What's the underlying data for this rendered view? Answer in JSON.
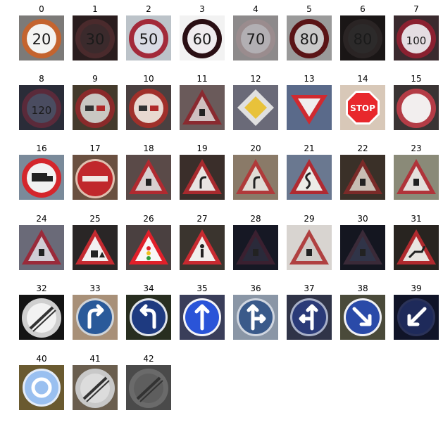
{
  "thumbnails": [
    {
      "label": "0",
      "shape": "circle-speed",
      "text": "20",
      "bg": "#7c7a78",
      "fill": "#f4f4f2",
      "ring": "#c4642f"
    },
    {
      "label": "1",
      "shape": "circle-speed",
      "text": "30",
      "bg": "#2a1d1e",
      "fill": "#3b2a2c",
      "ring": "#4a2a2c"
    },
    {
      "label": "2",
      "shape": "circle-speed",
      "text": "50",
      "bg": "#bcc3c9",
      "fill": "#d8dbe4",
      "ring": "#a32a3a"
    },
    {
      "label": "3",
      "shape": "circle-speed",
      "text": "60",
      "bg": "#f2f2f2",
      "fill": "#f0ecef",
      "ring": "#2a0f14"
    },
    {
      "label": "4",
      "shape": "circle-speed",
      "text": "70",
      "bg": "#8d8a8b",
      "fill": "#b2afb3",
      "ring": "#9a8c8e"
    },
    {
      "label": "5",
      "shape": "circle-speed",
      "text": "80",
      "bg": "#9a9a9a",
      "fill": "#c9c9c9",
      "ring": "#5a1416"
    },
    {
      "label": "6",
      "shape": "circle-speed",
      "text": "80",
      "bg": "#1a1616",
      "fill": "#2c2a2a",
      "ring": "#2a2424"
    },
    {
      "label": "7",
      "shape": "circle-speed",
      "text": "100",
      "bg": "#3a2a2e",
      "fill": "#e4dde2",
      "ring": "#8a2030"
    },
    {
      "label": "8",
      "shape": "circle-speed",
      "text": "120",
      "bg": "#2a2c38",
      "fill": "#4a4c60",
      "ring": "#5a2a3a"
    },
    {
      "label": "9",
      "shape": "circle-cars",
      "text": "",
      "bg": "#443a2c",
      "fill": "#c9c7c2",
      "ring": "#8a2a2a"
    },
    {
      "label": "10",
      "shape": "circle-cars",
      "text": "",
      "bg": "#4a4040",
      "fill": "#e8d8d0",
      "ring": "#a0302a"
    },
    {
      "label": "11",
      "shape": "triangle",
      "text": "",
      "bg": "#6a5a5a",
      "fill": "#cfc0c0",
      "ring": "#8a2a30"
    },
    {
      "label": "12",
      "shape": "diamond",
      "text": "",
      "bg": "#6a6a78",
      "fill": "#e8c23a",
      "ring": "#e0e0e0"
    },
    {
      "label": "13",
      "shape": "triangle-down",
      "text": "",
      "bg": "#5a6a8a",
      "fill": "#f0eeee",
      "ring": "#d02a30"
    },
    {
      "label": "14",
      "shape": "stop",
      "text": "STOP",
      "bg": "#d8c8b8",
      "fill": "#e8282c",
      "ring": "#ffffff"
    },
    {
      "label": "15",
      "shape": "circle-empty",
      "text": "",
      "bg": "#3a3434",
      "fill": "#f2eeee",
      "ring": "#b43c46"
    },
    {
      "label": "16",
      "shape": "circle-truck",
      "text": "",
      "bg": "#7a8a9a",
      "fill": "#f2f2f2",
      "ring": "#d4262c"
    },
    {
      "label": "17",
      "shape": "no-entry",
      "text": "",
      "bg": "#6a5040",
      "fill": "#c0282c",
      "ring": "#e0c0b0"
    },
    {
      "label": "18",
      "shape": "triangle",
      "text": "",
      "bg": "#5a4a48",
      "fill": "#d8d0d0",
      "ring": "#b02a30"
    },
    {
      "label": "19",
      "shape": "triangle-curve",
      "text": "",
      "bg": "#3a2e2a",
      "fill": "#e8e4e2",
      "ring": "#a82a2e"
    },
    {
      "label": "20",
      "shape": "triangle-curve",
      "text": "",
      "bg": "#8a7a68",
      "fill": "#e0dcd6",
      "ring": "#b03a3a"
    },
    {
      "label": "21",
      "shape": "triangle-double",
      "text": "",
      "bg": "#6a7890",
      "fill": "#ecece8",
      "ring": "#b02a32"
    },
    {
      "label": "22",
      "shape": "triangle",
      "text": "",
      "bg": "#3a3028",
      "fill": "#c8beb4",
      "ring": "#7a2a28"
    },
    {
      "label": "23",
      "shape": "triangle",
      "text": "",
      "bg": "#8a8a78",
      "fill": "#e4e0dc",
      "ring": "#b0343a"
    },
    {
      "label": "24",
      "shape": "triangle",
      "text": "",
      "bg": "#6a6a78",
      "fill": "#d0ccd4",
      "ring": "#9a2a3a"
    },
    {
      "label": "25",
      "shape": "triangle-work",
      "text": "",
      "bg": "#2a2626",
      "fill": "#f2f0f0",
      "ring": "#c42a30"
    },
    {
      "label": "26",
      "shape": "triangle-signal",
      "text": "",
      "bg": "#4a4040",
      "fill": "#f8f6f6",
      "ring": "#e0202a"
    },
    {
      "label": "27",
      "shape": "triangle-person",
      "text": "",
      "bg": "#3a342e",
      "fill": "#f0eeec",
      "ring": "#c82a30"
    },
    {
      "label": "28",
      "shape": "triangle",
      "text": "",
      "bg": "#161824",
      "fill": "#2a2a3a",
      "ring": "#3a2030"
    },
    {
      "label": "29",
      "shape": "triangle",
      "text": "",
      "bg": "#d8d4d0",
      "fill": "#d0ccc8",
      "ring": "#b04040"
    },
    {
      "label": "30",
      "shape": "triangle",
      "text": "",
      "bg": "#141620",
      "fill": "#303448",
      "ring": "#3a2a38"
    },
    {
      "label": "31",
      "shape": "triangle-deer",
      "text": "",
      "bg": "#282420",
      "fill": "#e8e4e0",
      "ring": "#b02a2e"
    },
    {
      "label": "32",
      "shape": "circle-end",
      "text": "",
      "bg": "#141414",
      "fill": "#f2f2f2",
      "ring": "#cfcfcf"
    },
    {
      "label": "33",
      "shape": "blue-turn-right",
      "text": "",
      "bg": "#a89078",
      "fill": "#2a5a9a",
      "ring": "#d0d4d8"
    },
    {
      "label": "34",
      "shape": "blue-turn-left",
      "text": "",
      "bg": "#282e20",
      "fill": "#1e3a80",
      "ring": "#e0e4ea"
    },
    {
      "label": "35",
      "shape": "blue-ahead",
      "text": "",
      "bg": "#3a3e5a",
      "fill": "#2a54d8",
      "ring": "#f4f4f8"
    },
    {
      "label": "36",
      "shape": "blue-ahead-right",
      "text": "",
      "bg": "#8a96a6",
      "fill": "#3a5a8a",
      "ring": "#d0d6e0"
    },
    {
      "label": "37",
      "shape": "blue-ahead-left",
      "text": "",
      "bg": "#303448",
      "fill": "#2a3a78",
      "ring": "#a8b0c8"
    },
    {
      "label": "38",
      "shape": "blue-keep-right",
      "text": "",
      "bg": "#4a4a3a",
      "fill": "#2a4aa8",
      "ring": "#f0f0f4"
    },
    {
      "label": "39",
      "shape": "blue-keep-left",
      "text": "",
      "bg": "#101428",
      "fill": "#1e2a5a",
      "ring": "#2a3258"
    },
    {
      "label": "40",
      "shape": "blue-roundabout",
      "text": "",
      "bg": "#6a5a30",
      "fill": "#9ac0f0",
      "ring": "#e4ecf8"
    },
    {
      "label": "41",
      "shape": "circle-end-nopass",
      "text": "",
      "bg": "#6a5e4e",
      "fill": "#dcdcdc",
      "ring": "#c8c8c8"
    },
    {
      "label": "42",
      "shape": "circle-end-nopass",
      "text": "",
      "bg": "#4a4a4a",
      "fill": "#5e5e5e",
      "ring": "#6a6a6a"
    }
  ]
}
